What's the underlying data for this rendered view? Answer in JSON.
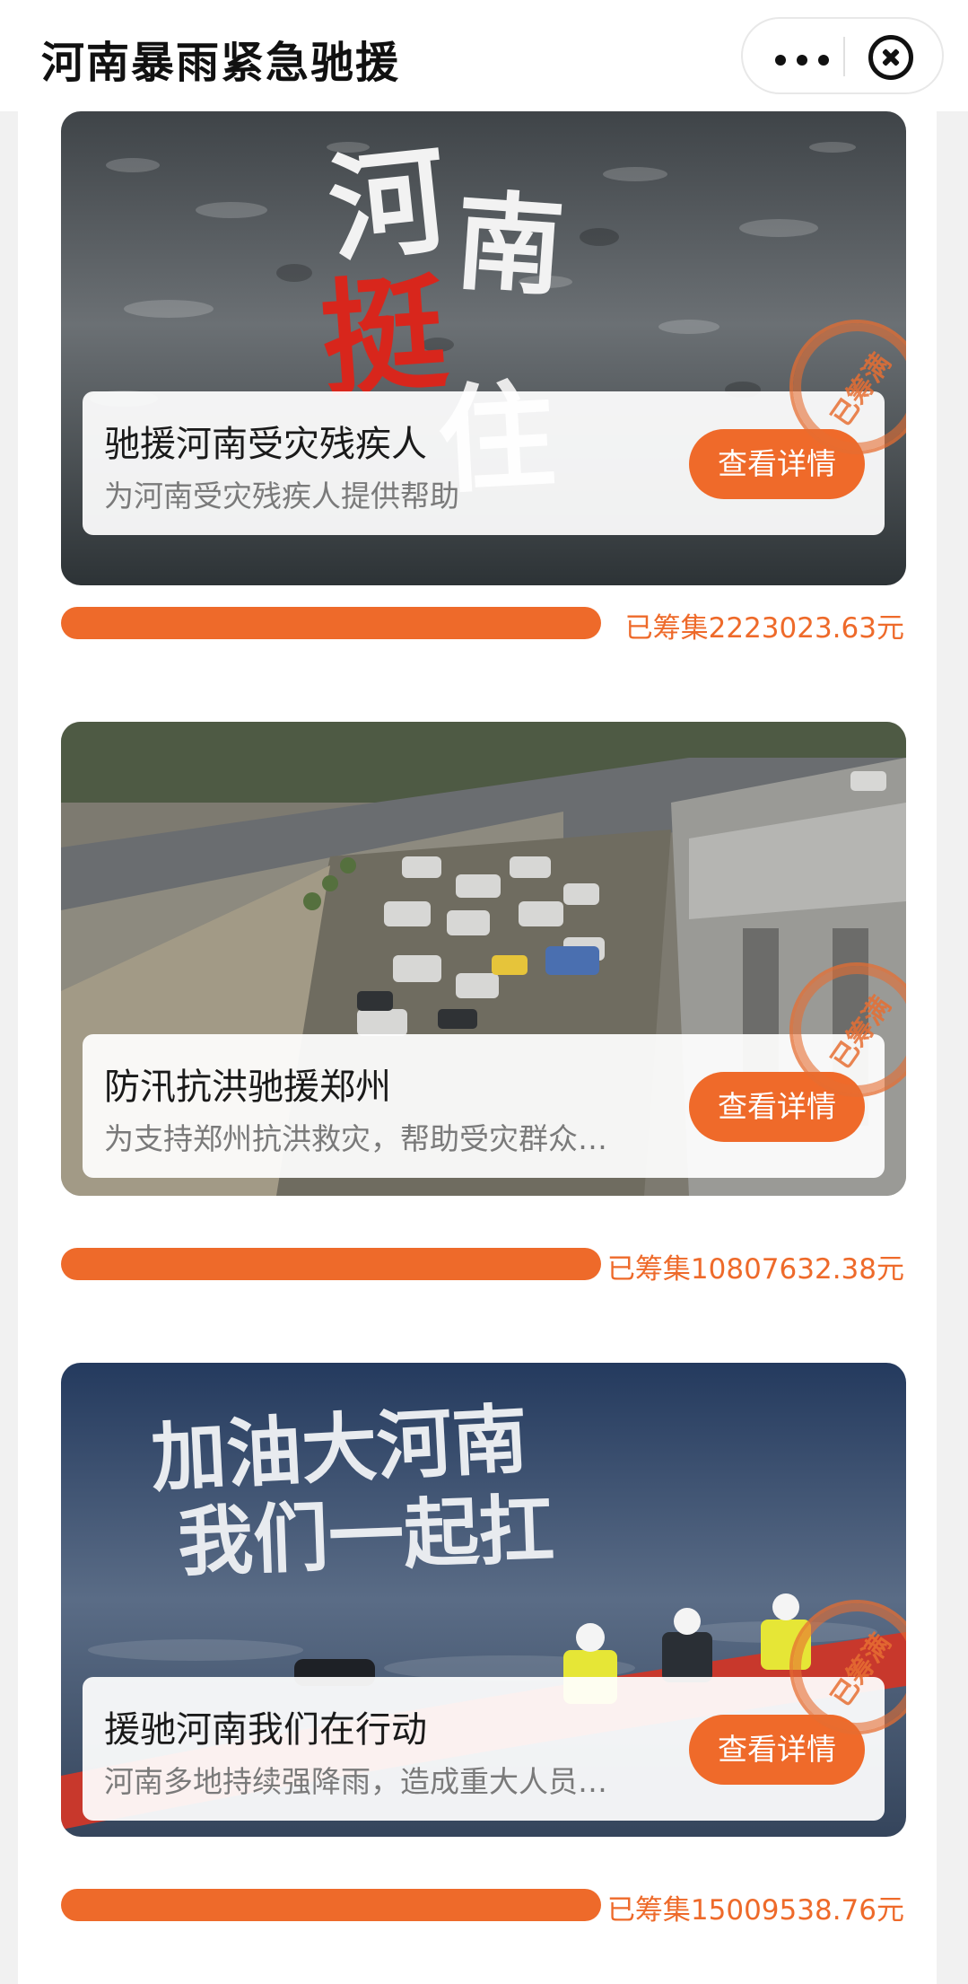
{
  "header": {
    "title": "河南暴雨紧急驰援"
  },
  "cards": [
    {
      "title": "驰援河南受灾残疾人",
      "description": "为河南受灾残疾人提供帮助",
      "button_label": "查看详情",
      "stamp": "已筹满",
      "raised_label": "已筹集2223023.63元",
      "progress": 1.0,
      "image_text": [
        "河",
        "南",
        "挺",
        "住"
      ]
    },
    {
      "title": "防汛抗洪驰援郑州",
      "description": "为支持郑州抗洪救灾，帮助受灾群众…",
      "button_label": "查看详情",
      "stamp": "已筹满",
      "raised_label": "已筹集10807632.38元",
      "progress": 1.0
    },
    {
      "title": "援驰河南我们在行动",
      "description": "河南多地持续强降雨，造成重大人员…",
      "button_label": "查看详情",
      "stamp": "已筹满",
      "raised_label": "已筹集15009538.76元",
      "progress": 1.0,
      "image_text": [
        "加油大河南",
        "我们一起扛"
      ]
    }
  ],
  "colors": {
    "accent": "#ef6a2a",
    "stamp": "#e66e32"
  }
}
